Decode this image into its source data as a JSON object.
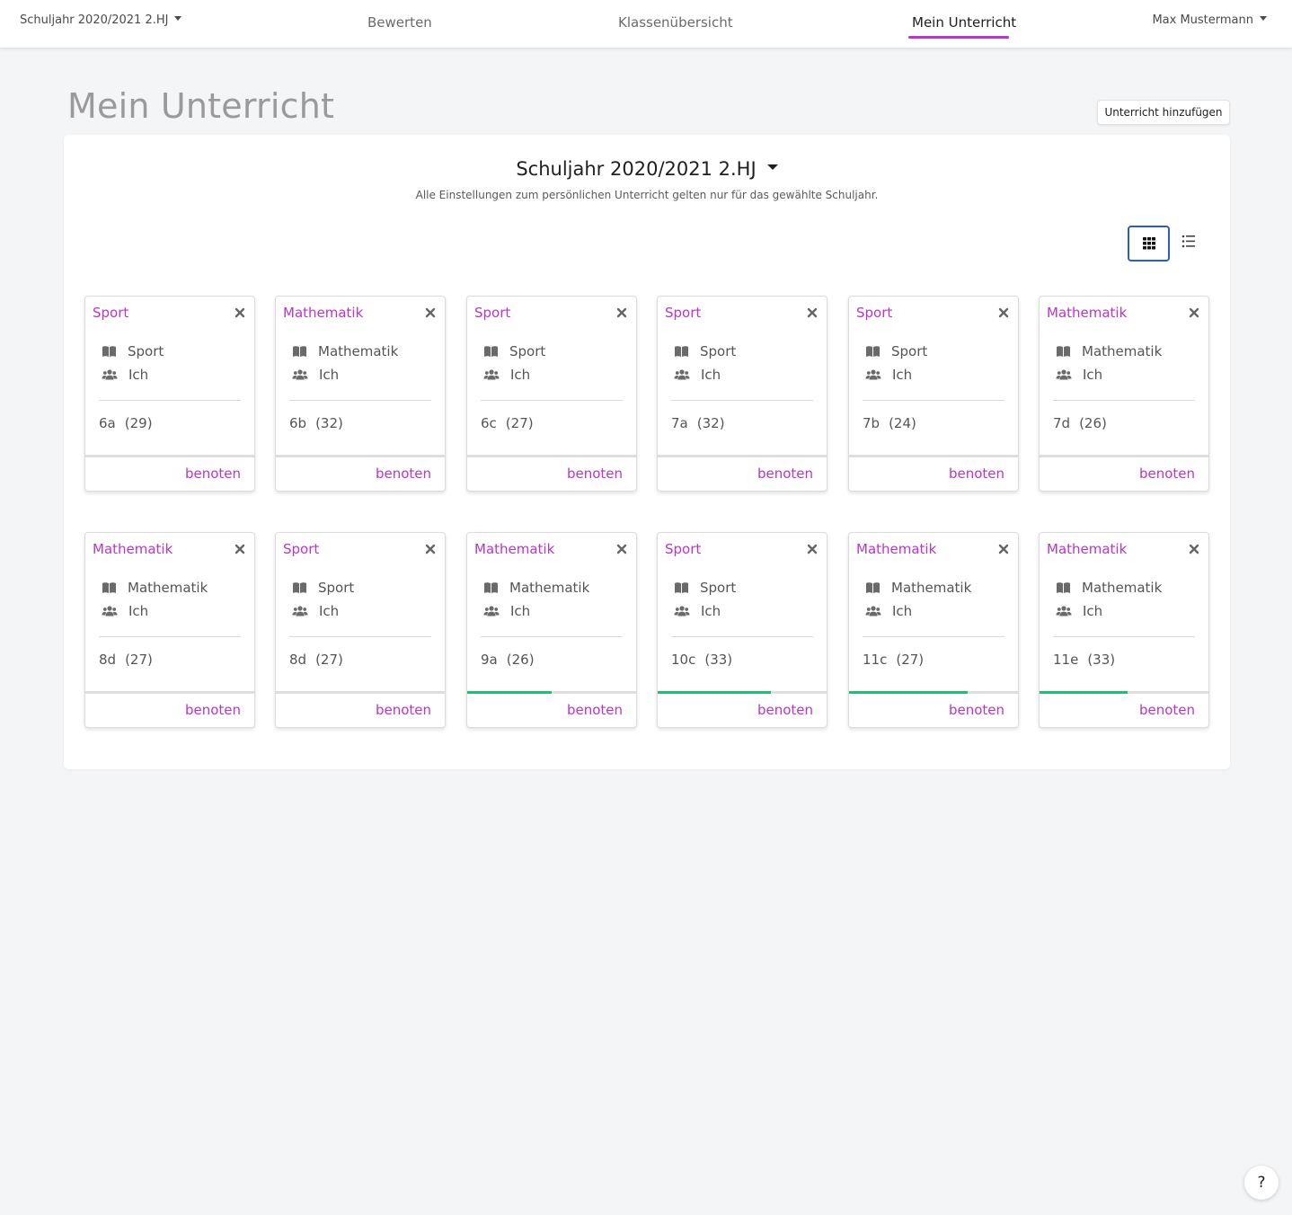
{
  "nav": {
    "school_year": "Schuljahr 2020/2021 2.HJ",
    "links": [
      "Bewerten",
      "Klassenübersicht",
      "Mein Unterricht"
    ],
    "active": "Mein Unterricht",
    "user": "Max Mustermann"
  },
  "page": {
    "title": "Mein Unterricht",
    "add_button": "Unterricht hinzufügen",
    "year_select": "Schuljahr 2020/2021 2.HJ",
    "year_note": "Alle Einstellungen zum persönlichen Unterricht gelten nur für das gewählte Schuljahr.",
    "view_modes": [
      "grid-icon",
      "list-icon"
    ],
    "active_view": "grid"
  },
  "accent_color": "#b836c8",
  "progress_color": "#1fbf6c",
  "cards": [
    {
      "title": "Sport",
      "subject": "Sport",
      "teacher": "Ich",
      "class": "6a",
      "count": "(29)",
      "progress": 0,
      "action": "benoten"
    },
    {
      "title": "Mathematik",
      "subject": "Mathematik",
      "teacher": "Ich",
      "class": "6b",
      "count": "(32)",
      "progress": 0,
      "action": "benoten"
    },
    {
      "title": "Sport",
      "subject": "Sport",
      "teacher": "Ich",
      "class": "6c",
      "count": "(27)",
      "progress": 0,
      "action": "benoten"
    },
    {
      "title": "Sport",
      "subject": "Sport",
      "teacher": "Ich",
      "class": "7a",
      "count": "(32)",
      "progress": 0,
      "action": "benoten"
    },
    {
      "title": "Sport",
      "subject": "Sport",
      "teacher": "Ich",
      "class": "7b",
      "count": "(24)",
      "progress": 0,
      "action": "benoten"
    },
    {
      "title": "Mathematik",
      "subject": "Mathematik",
      "teacher": "Ich",
      "class": "7d",
      "count": "(26)",
      "progress": 0,
      "action": "benoten"
    },
    {
      "title": "Mathematik",
      "subject": "Mathematik",
      "teacher": "Ich",
      "class": "8d",
      "count": "(27)",
      "progress": 0,
      "action": "benoten"
    },
    {
      "title": "Sport",
      "subject": "Sport",
      "teacher": "Ich",
      "class": "8d",
      "count": "(27)",
      "progress": 0,
      "action": "benoten"
    },
    {
      "title": "Mathematik",
      "subject": "Mathematik",
      "teacher": "Ich",
      "class": "9a",
      "count": "(26)",
      "progress": 0.5,
      "action": "benoten"
    },
    {
      "title": "Sport",
      "subject": "Sport",
      "teacher": "Ich",
      "class": "10c",
      "count": "(33)",
      "progress": 0.67,
      "action": "benoten"
    },
    {
      "title": "Mathematik",
      "subject": "Mathematik",
      "teacher": "Ich",
      "class": "11c",
      "count": "(27)",
      "progress": 0.7,
      "action": "benoten"
    },
    {
      "title": "Mathematik",
      "subject": "Mathematik",
      "teacher": "Ich",
      "class": "11e",
      "count": "(33)",
      "progress": 0.52,
      "action": "benoten"
    }
  ],
  "help": "?"
}
